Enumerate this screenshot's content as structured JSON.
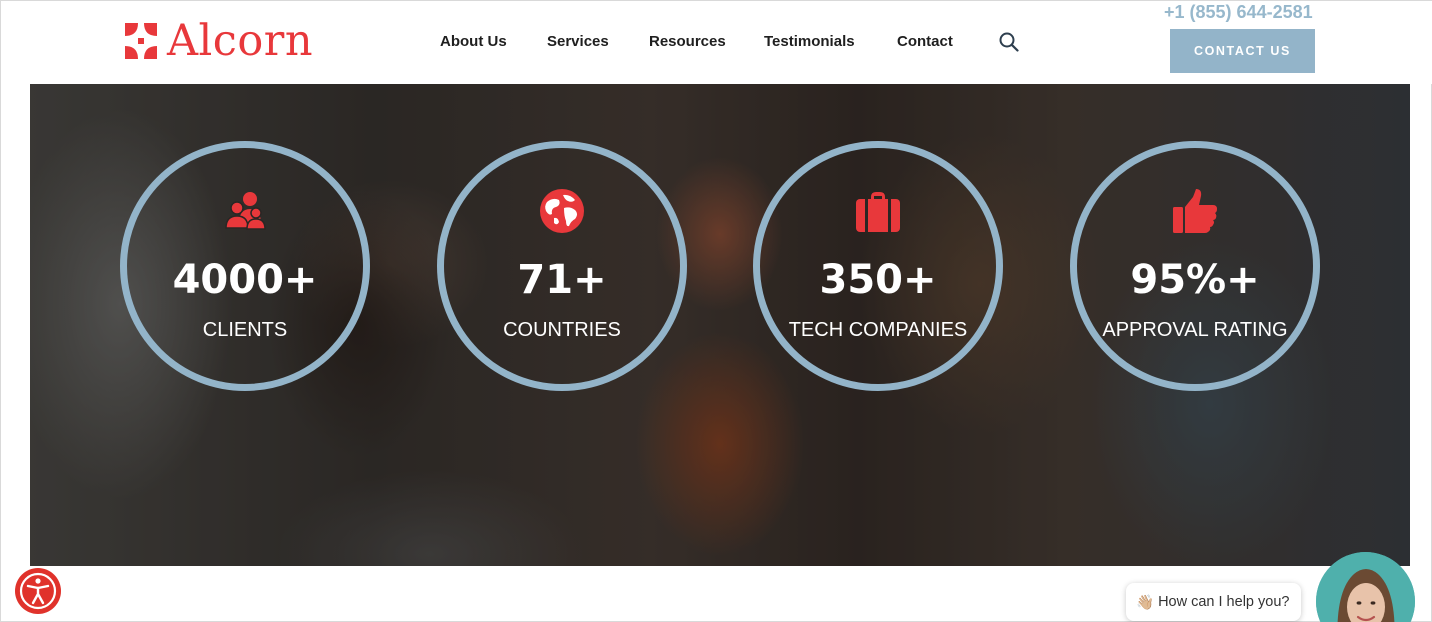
{
  "brand": {
    "name": "Alcorn",
    "color": "#e8383b"
  },
  "nav": {
    "items": [
      {
        "label": "About Us"
      },
      {
        "label": "Services"
      },
      {
        "label": "Resources"
      },
      {
        "label": "Testimonials"
      },
      {
        "label": "Contact"
      }
    ],
    "search_icon": "search-icon"
  },
  "header": {
    "phone": "+1 (855) 644-2581",
    "cta_label": "CONTACT US",
    "accent_color": "#93b4c9"
  },
  "stats": [
    {
      "icon": "users-icon",
      "number": "4000+",
      "label": "CLIENTS"
    },
    {
      "icon": "globe-icon",
      "number": "71+",
      "label": "COUNTRIES"
    },
    {
      "icon": "briefcase-icon",
      "number": "350+",
      "label": "TECH COMPANIES"
    },
    {
      "icon": "thumbs-up-icon",
      "number": "95%+",
      "label": "APPROVAL RATING"
    }
  ],
  "widgets": {
    "accessibility_icon": "accessibility-icon",
    "chat_prompt": "How can I help you?",
    "chat_emoji": "👋🏼"
  }
}
